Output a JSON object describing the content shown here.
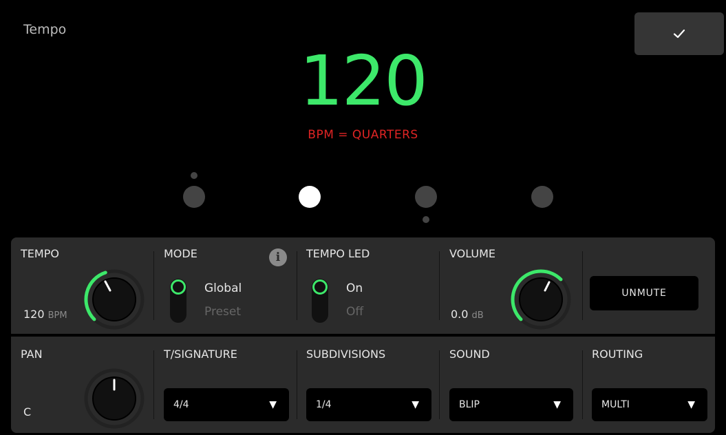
{
  "header": {
    "title": "Tempo",
    "confirm_icon": "check-icon",
    "tempo_value": "120",
    "caption": "BPM = QUARTERS"
  },
  "beats": {
    "count": 4,
    "active_index": 1
  },
  "colors": {
    "accent": "#3de86a",
    "caption": "#e02424",
    "panel": "#2b2b2b",
    "knob": "#111111"
  },
  "tempo": {
    "label": "TEMPO",
    "value": "120",
    "unit": "BPM"
  },
  "mode": {
    "label": "MODE",
    "options": [
      "Global",
      "Preset"
    ],
    "selected": "Global",
    "info_icon": "info-icon"
  },
  "tempo_led": {
    "label": "TEMPO LED",
    "options": [
      "On",
      "Off"
    ],
    "selected": "On"
  },
  "volume": {
    "label": "VOLUME",
    "value": "0.0",
    "unit": "dB"
  },
  "mute": {
    "label": "UNMUTE"
  },
  "pan": {
    "label": "PAN",
    "value": "C"
  },
  "time_signature": {
    "label": "T/SIGNATURE",
    "value": "4/4"
  },
  "subdivisions": {
    "label": "SUBDIVISIONS",
    "value": "1/4"
  },
  "sound": {
    "label": "SOUND",
    "value": "BLIP"
  },
  "routing": {
    "label": "ROUTING",
    "value": "MULTI"
  }
}
